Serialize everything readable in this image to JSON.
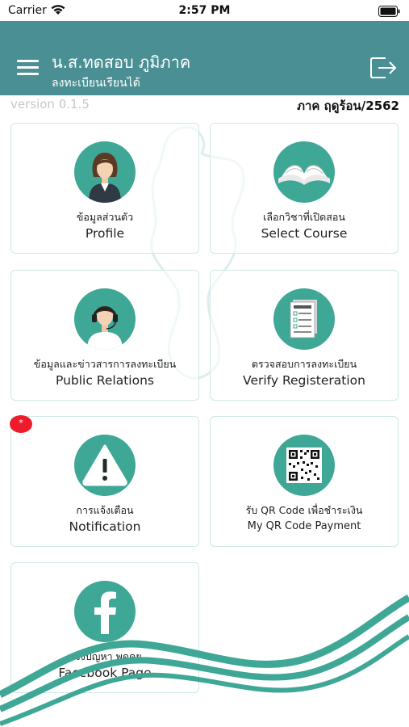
{
  "status_bar": {
    "carrier": "Carrier",
    "time": "2:57 PM"
  },
  "header": {
    "user_name": "น.ส.ทดสอบ ภูมิภาค",
    "user_status": "ลงทะเบียนเรียนได้",
    "accent_color": "#4a8f94"
  },
  "info": {
    "version": "version 0.1.5",
    "term": "ภาค ฤดูร้อน/2562"
  },
  "menu": {
    "items": [
      {
        "label_th": "ข้อมูลส่วนตัว",
        "label_en": "Profile",
        "icon": "person-icon"
      },
      {
        "label_th": "เลือกวิชาที่เปิดสอน",
        "label_en": "Select Course",
        "icon": "open-book-icon"
      },
      {
        "label_th": "ข้อมูลและข่าวสารการลงทะเบียน",
        "label_en": "Public Relations",
        "icon": "call-center-icon"
      },
      {
        "label_th": "ตรวจสอบการลงทะเบียน",
        "label_en": "Verify Registeration",
        "icon": "document-checklist-icon"
      },
      {
        "label_th": "การแจ้งเตือน",
        "label_en": "Notification",
        "icon": "warning-icon",
        "badge": "*"
      },
      {
        "label_th": "รับ QR Code เพื่อชำระเงิน",
        "label_en": "My QR Code Payment",
        "icon": "qr-code-icon"
      },
      {
        "label_th": "แจ้งปัญหา พูดคุย",
        "label_en": "Facebook Page",
        "icon": "facebook-icon"
      }
    ]
  },
  "colors": {
    "icon_bg": "#3fa796",
    "badge": "#ee1c2a",
    "card_border": "#cfe8e6"
  }
}
